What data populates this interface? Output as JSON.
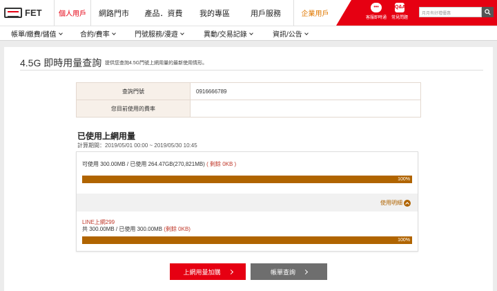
{
  "header": {
    "logo_text": "FET",
    "personal": "個人用戶",
    "nav": [
      "網路門市",
      "產品．資費",
      "我的專區",
      "用戶服務"
    ],
    "business": "企業用戶",
    "tools": [
      {
        "label": "客服即時通",
        "icon": "chat-icon"
      },
      {
        "label": "常見問題",
        "icon": "faq-icon",
        "glyph": "Q&A"
      }
    ],
    "search_placeholder": "月月有好禮優惠"
  },
  "subnav": [
    "帳單/繳費/儲值",
    "合約/費率",
    "門號服務/漫遊",
    "異動/交易記錄",
    "資訊/公告"
  ],
  "page": {
    "title": "4.5G 即時用量查詢",
    "description": "提供您查詢4.5G門號上網用量的最新使用情形。"
  },
  "info": [
    {
      "label": "查詢門號",
      "value": "0916666789"
    },
    {
      "label": "您目前使用的費率",
      "value": ""
    }
  ],
  "usage": {
    "title": "已使用上網用量",
    "period": "計算期間：2019/05/01 00:00 ~ 2019/05/30 10:45",
    "summary_main": "可使用 300.00MB / 已使用 264.47GB(270,821MB)",
    "summary_remain": "( 剩餘 0KB )",
    "total_percent": 100,
    "total_percent_label": "100%",
    "detail_link": "使用明細",
    "plan": {
      "name": "LINE上網299",
      "usage_main": "共 300.00MB / 已使用 300.00MB",
      "usage_remain": "(剩餘 0KB)",
      "percent": 100,
      "percent_label": "100%"
    }
  },
  "buttons": {
    "add_data": "上網用量加購",
    "bill_query": "帳單查詢"
  },
  "colors": {
    "brand_red": "#e60012",
    "bar_fill": "#b06400",
    "business_orange": "#e07800"
  }
}
